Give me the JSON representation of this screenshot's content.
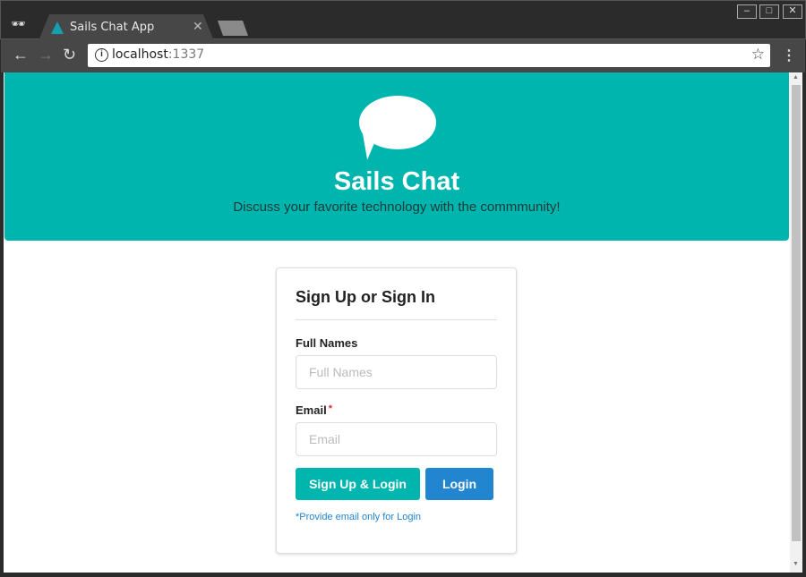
{
  "browser": {
    "tab_title": "Sails Chat App",
    "url_host": "localhost",
    "url_port": ":1337"
  },
  "hero": {
    "title": "Sails Chat",
    "subtitle": "Discuss your favorite technology with the commmunity!"
  },
  "form": {
    "heading": "Sign Up or Sign In",
    "full_names_label": "Full Names",
    "full_names_placeholder": "Full Names",
    "email_label": "Email",
    "required_mark": "*",
    "email_placeholder": "Email",
    "signup_button": "Sign Up & Login",
    "login_button": "Login",
    "note": "*Provide email only for Login"
  },
  "colors": {
    "teal": "#00b5ad",
    "blue": "#2185d0",
    "required": "#db2828"
  }
}
